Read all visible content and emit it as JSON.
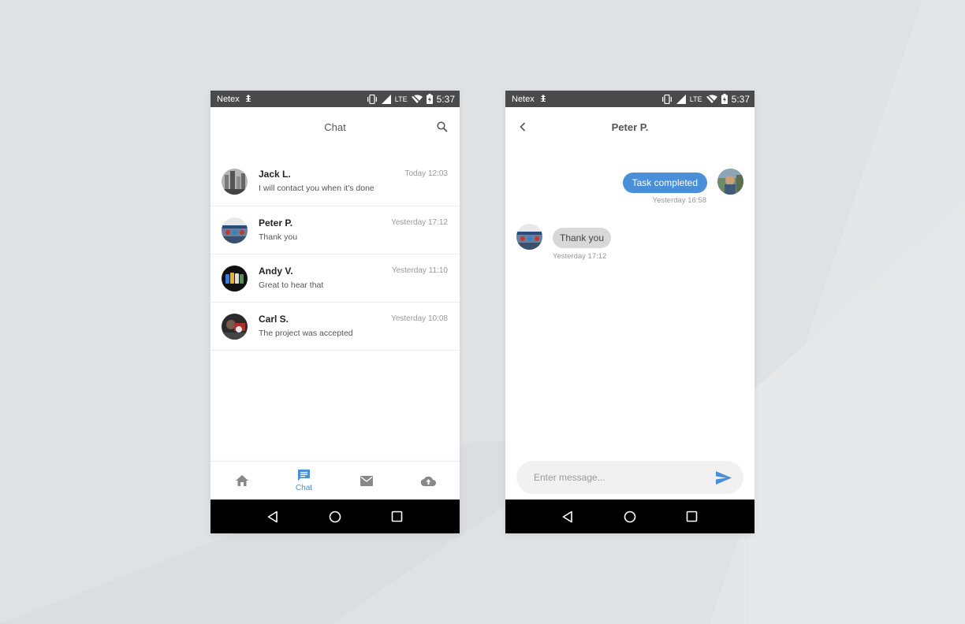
{
  "colors": {
    "accent": "#4a90d9",
    "status_bar": "#4a4a4a",
    "background": "#dfe2e5"
  },
  "status_bar": {
    "carrier": "Netex",
    "network": "LTE",
    "time": "5:37",
    "icons": [
      "usb-debug-icon",
      "vibrate-icon",
      "signal-icon",
      "wifi-icon",
      "battery-charging-icon"
    ]
  },
  "chat_list": {
    "title": "Chat",
    "items": [
      {
        "name": "Jack L.",
        "preview": "I will contact you when it's done",
        "time": "Today 12:03"
      },
      {
        "name": "Peter P.",
        "preview": "Thank you",
        "time": "Yesterday 17:12"
      },
      {
        "name": "Andy V.",
        "preview": "Great to hear that",
        "time": "Yesterday 11:10"
      },
      {
        "name": "Carl S.",
        "preview": "The project was accepted",
        "time": "Yesterday 10:08"
      }
    ],
    "bottom_nav": {
      "active_label": "Chat",
      "icons": [
        "home-icon",
        "chat-icon",
        "mail-icon",
        "cloud-upload-icon"
      ]
    }
  },
  "conversation": {
    "title": "Peter P.",
    "messages": [
      {
        "direction": "sent",
        "text": "Task completed",
        "time": "Yesterday  16:58"
      },
      {
        "direction": "received",
        "text": "Thank you",
        "time": "Yesterday  17:12"
      }
    ],
    "composer": {
      "placeholder": "Enter message...",
      "value": ""
    }
  }
}
